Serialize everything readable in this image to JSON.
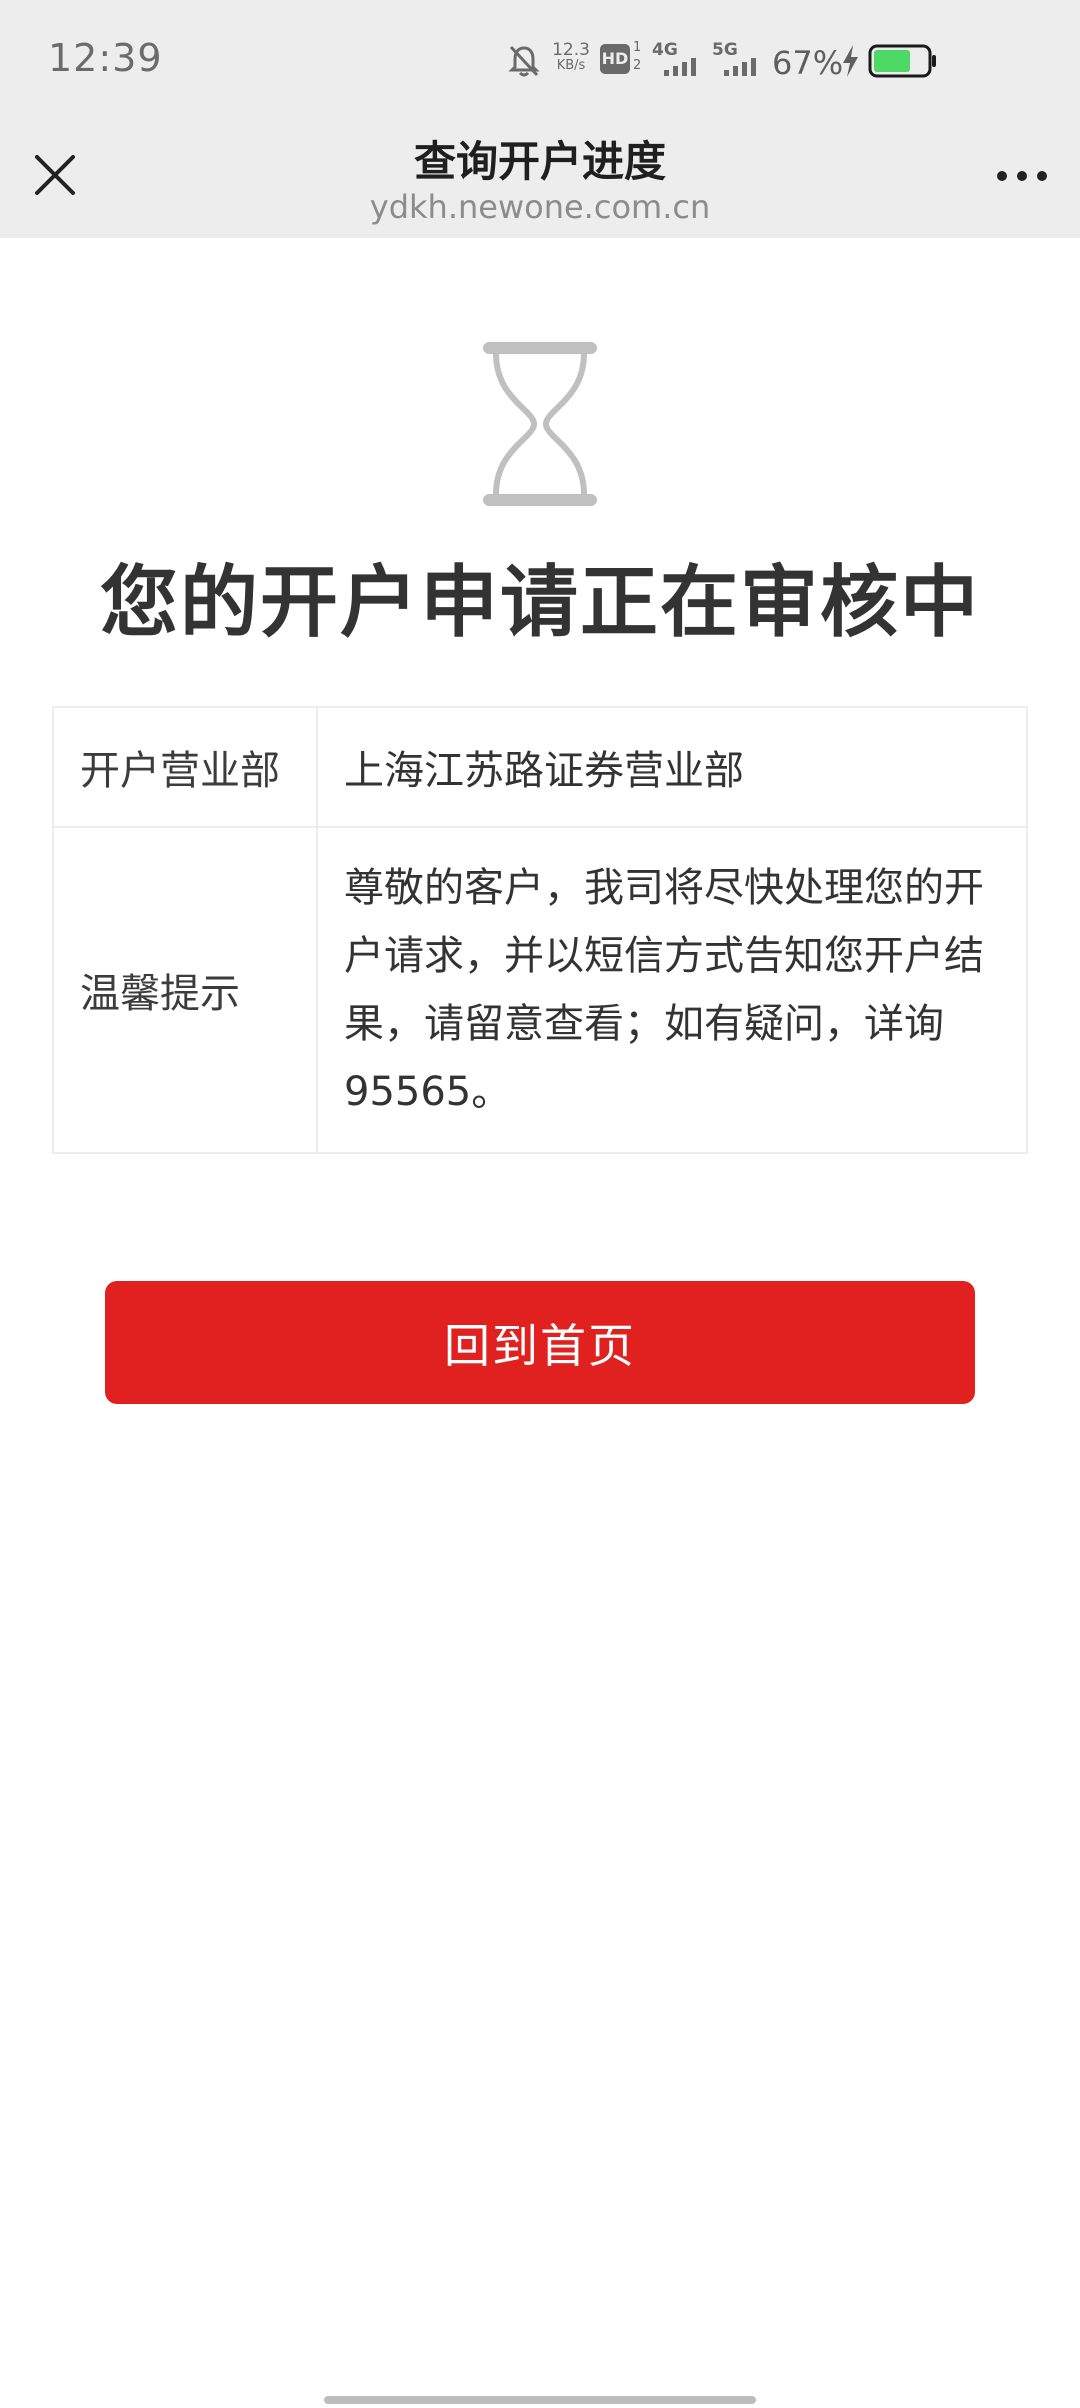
{
  "status_bar": {
    "time": "12:39",
    "net_speed_value": "12.3",
    "net_speed_unit": "KB/s",
    "hd_badge": "HD",
    "sim1_network": "4G",
    "sim2_network": "5G",
    "battery_percent": "67%",
    "icons": [
      "mute-bell-icon",
      "hd-icon",
      "signal-icon",
      "charging-bolt-icon",
      "battery-icon"
    ]
  },
  "title_bar": {
    "title": "查询开户进度",
    "url": "ydkh.newone.com.cn",
    "icons": [
      "close-icon",
      "more-icon"
    ]
  },
  "main": {
    "status_icon": "hourglass-icon",
    "status_title": "您的开户申请正在审核中",
    "rows": [
      {
        "label": "开户营业部",
        "value": "上海江苏路证券营业部"
      },
      {
        "label": "温馨提示",
        "value": "尊敬的客户，我司将尽快处理您的开户请求，并以短信方式告知您开户结果，请留意查看；如有疑问，详询95565。"
      }
    ],
    "home_button_label": "回到首页"
  },
  "colors": {
    "accent": "#e1211f",
    "header_bg": "#ededed",
    "battery_fill": "#4cd964"
  }
}
